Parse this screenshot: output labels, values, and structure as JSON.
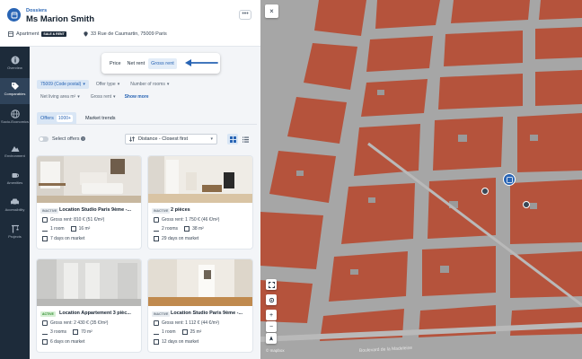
{
  "header": {
    "kicker": "Dossiers",
    "title": "Ms Marion Smith",
    "more": "•••",
    "property_type": "Apartment",
    "property_tag": "SALE & RENT",
    "address": "33 Rue de Caumartin, 75009 Paris"
  },
  "nav": [
    {
      "label": "Overview",
      "icon": "info-icon"
    },
    {
      "label": "Comparables",
      "icon": "tag-icon",
      "active": true
    },
    {
      "label": "Socio-Economics",
      "icon": "globe-icon"
    },
    {
      "label": "Environment",
      "icon": "mountain-icon"
    },
    {
      "label": "Amenities",
      "icon": "coffee-icon"
    },
    {
      "label": "Accessibility",
      "icon": "car-icon"
    },
    {
      "label": "Projects",
      "icon": "crane-icon"
    }
  ],
  "rent_toggle": {
    "options": [
      "Price",
      "Net rent",
      "Gross rent"
    ],
    "selected": "Gross rent"
  },
  "filters": {
    "row1": [
      "75009 (Code postal)",
      "Offer type",
      "Number of rooms"
    ],
    "row2": [
      "Net living area m²",
      "Gross rent"
    ],
    "show_more": "Show more"
  },
  "tabs": {
    "offers": "Offers",
    "offers_count": "1000+",
    "market_trends": "Market trends"
  },
  "sort": {
    "select_offers": "Select offers",
    "sort_value": "Distance - Closest first"
  },
  "cards": [
    {
      "status": "INACTIVE",
      "title": "Location Studio Paris 9ème -...",
      "rent": "Gross rent: 810 € (51 €/m²)",
      "rooms": "1 room",
      "area": "16 m²",
      "days": "7 days on market"
    },
    {
      "status": "INACTIVE",
      "title": "2 pièces",
      "rent": "Gross rent: 1 750 € (46 €/m²)",
      "rooms": "2 rooms",
      "area": "38 m²",
      "days": "29 days on market"
    },
    {
      "status": "ACTIVE",
      "title": "Location Appartement 3 pièc...",
      "rent": "Gross rent: 2 430 € (35 €/m²)",
      "rooms": "3 rooms",
      "area": "70 m²",
      "days": "6 days on market"
    },
    {
      "status": "INACTIVE",
      "title": "Location Studio Paris 9ème -...",
      "rent": "Gross rent: 1 112 € (44 €/m²)",
      "rooms": "1 room",
      "area": "25 m²",
      "days": "12 days on market"
    }
  ],
  "map": {
    "close": "×",
    "street_label": "Boulevard de la Madeleine",
    "attribution": "© mapbox",
    "zoom_in": "+",
    "zoom_out": "−",
    "colors": {
      "building": "#b5533c",
      "street": "#a9a9a9",
      "accent": "#2864b4"
    }
  }
}
